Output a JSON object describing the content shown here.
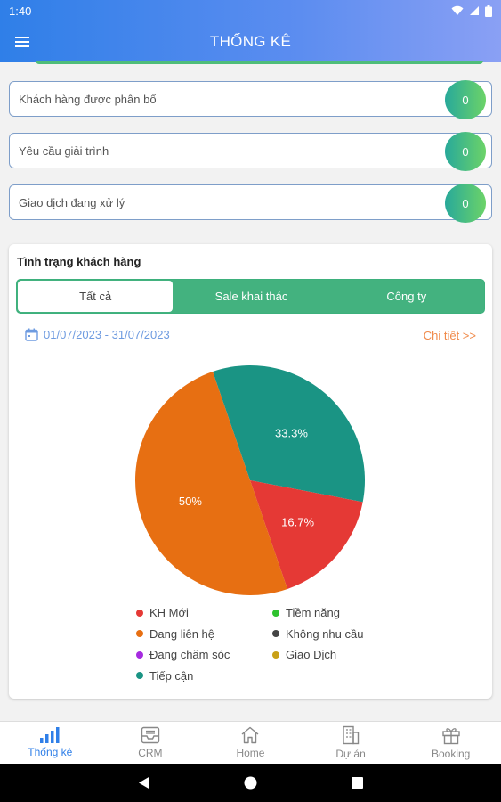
{
  "status_bar": {
    "time": "1:40"
  },
  "header": {
    "title": "THỐNG KÊ"
  },
  "stats": [
    {
      "label": "Khách hàng được phân bổ",
      "value": "0"
    },
    {
      "label": "Yêu cầu giải trình",
      "value": "0"
    },
    {
      "label": "Giao dịch đang xử lý",
      "value": "0"
    }
  ],
  "card": {
    "title": "Tình trạng khách hàng",
    "tabs": [
      "Tất cả",
      "Sale khai thác",
      "Công ty"
    ],
    "active_tab": "Tất cả",
    "date_range": "01/07/2023 - 31/07/2023",
    "detail_link": "Chi tiết >>"
  },
  "chart_data": {
    "type": "pie",
    "slices": [
      {
        "label": "Tiếp cận",
        "value": 33.3,
        "display": "33.3%",
        "color": "#1a9484"
      },
      {
        "label": "KH Mới",
        "value": 16.7,
        "display": "16.7%",
        "color": "#e53935"
      },
      {
        "label": "Đang liên hệ",
        "value": 50,
        "display": "50%",
        "color": "#e76f12"
      }
    ],
    "legend": [
      {
        "label": "KH Mới",
        "color": "#e53935"
      },
      {
        "label": "Tiềm năng",
        "color": "#2ec22e"
      },
      {
        "label": "Đang liên hệ",
        "color": "#e76f12"
      },
      {
        "label": "Không nhu cầu",
        "color": "#444444"
      },
      {
        "label": "Đang chăm sóc",
        "color": "#a62be0"
      },
      {
        "label": "Giao Dịch",
        "color": "#c9a016"
      },
      {
        "label": "Tiếp cận",
        "color": "#1a9484"
      }
    ]
  },
  "bottom_nav": [
    {
      "label": "Thống kê",
      "icon": "bar-chart-icon",
      "active": true
    },
    {
      "label": "CRM",
      "icon": "inbox-icon",
      "active": false
    },
    {
      "label": "Home",
      "icon": "home-icon",
      "active": false
    },
    {
      "label": "Dự án",
      "icon": "building-icon",
      "active": false
    },
    {
      "label": "Booking",
      "icon": "gift-icon",
      "active": false
    }
  ],
  "colors": {
    "primary": "#2f7fe8",
    "accent_green": "#43b27f",
    "link_orange": "#f08a4a"
  }
}
